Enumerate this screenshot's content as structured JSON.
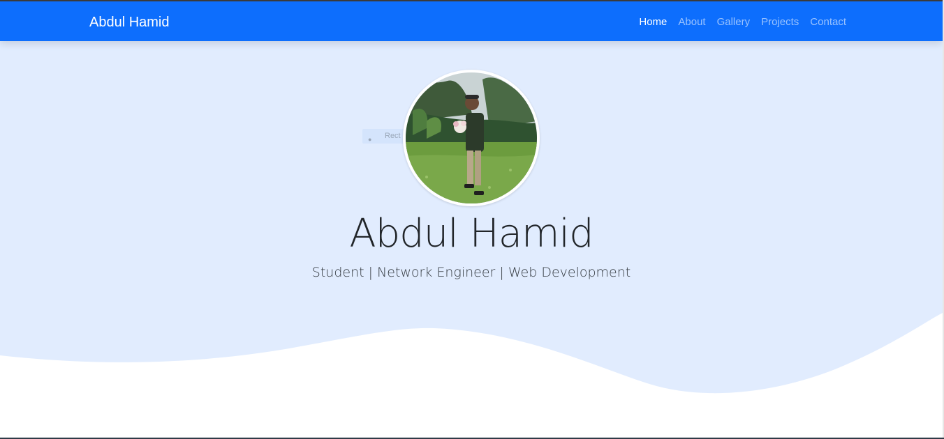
{
  "navbar": {
    "brand": "Abdul Hamid",
    "links": [
      {
        "label": "Home",
        "active": true
      },
      {
        "label": "About",
        "active": false
      },
      {
        "label": "Gallery",
        "active": false
      },
      {
        "label": "Projects",
        "active": false
      },
      {
        "label": "Contact",
        "active": false
      }
    ]
  },
  "hero": {
    "name": "Abdul Hamid",
    "tagline": "Student | Network Engineer | Web Development",
    "ghost_label": "Rect",
    "profile_image": "profile-photo"
  },
  "colors": {
    "navbar_bg": "#0d6efd",
    "hero_bg": "#e1ecfe",
    "wave_fill": "#ffffff"
  }
}
